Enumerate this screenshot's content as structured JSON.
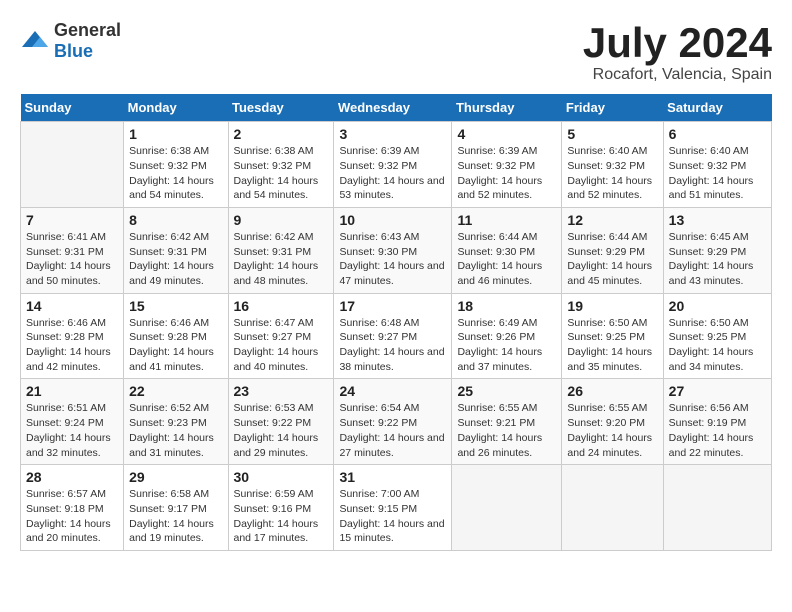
{
  "header": {
    "logo_general": "General",
    "logo_blue": "Blue",
    "title": "July 2024",
    "subtitle": "Rocafort, Valencia, Spain"
  },
  "days_of_week": [
    "Sunday",
    "Monday",
    "Tuesday",
    "Wednesday",
    "Thursday",
    "Friday",
    "Saturday"
  ],
  "weeks": [
    [
      {
        "day": "",
        "sunrise": "",
        "sunset": "",
        "daylight": "",
        "empty": true
      },
      {
        "day": "1",
        "sunrise": "Sunrise: 6:38 AM",
        "sunset": "Sunset: 9:32 PM",
        "daylight": "Daylight: 14 hours and 54 minutes."
      },
      {
        "day": "2",
        "sunrise": "Sunrise: 6:38 AM",
        "sunset": "Sunset: 9:32 PM",
        "daylight": "Daylight: 14 hours and 54 minutes."
      },
      {
        "day": "3",
        "sunrise": "Sunrise: 6:39 AM",
        "sunset": "Sunset: 9:32 PM",
        "daylight": "Daylight: 14 hours and 53 minutes."
      },
      {
        "day": "4",
        "sunrise": "Sunrise: 6:39 AM",
        "sunset": "Sunset: 9:32 PM",
        "daylight": "Daylight: 14 hours and 52 minutes."
      },
      {
        "day": "5",
        "sunrise": "Sunrise: 6:40 AM",
        "sunset": "Sunset: 9:32 PM",
        "daylight": "Daylight: 14 hours and 52 minutes."
      },
      {
        "day": "6",
        "sunrise": "Sunrise: 6:40 AM",
        "sunset": "Sunset: 9:32 PM",
        "daylight": "Daylight: 14 hours and 51 minutes."
      }
    ],
    [
      {
        "day": "7",
        "sunrise": "Sunrise: 6:41 AM",
        "sunset": "Sunset: 9:31 PM",
        "daylight": "Daylight: 14 hours and 50 minutes."
      },
      {
        "day": "8",
        "sunrise": "Sunrise: 6:42 AM",
        "sunset": "Sunset: 9:31 PM",
        "daylight": "Daylight: 14 hours and 49 minutes."
      },
      {
        "day": "9",
        "sunrise": "Sunrise: 6:42 AM",
        "sunset": "Sunset: 9:31 PM",
        "daylight": "Daylight: 14 hours and 48 minutes."
      },
      {
        "day": "10",
        "sunrise": "Sunrise: 6:43 AM",
        "sunset": "Sunset: 9:30 PM",
        "daylight": "Daylight: 14 hours and 47 minutes."
      },
      {
        "day": "11",
        "sunrise": "Sunrise: 6:44 AM",
        "sunset": "Sunset: 9:30 PM",
        "daylight": "Daylight: 14 hours and 46 minutes."
      },
      {
        "day": "12",
        "sunrise": "Sunrise: 6:44 AM",
        "sunset": "Sunset: 9:29 PM",
        "daylight": "Daylight: 14 hours and 45 minutes."
      },
      {
        "day": "13",
        "sunrise": "Sunrise: 6:45 AM",
        "sunset": "Sunset: 9:29 PM",
        "daylight": "Daylight: 14 hours and 43 minutes."
      }
    ],
    [
      {
        "day": "14",
        "sunrise": "Sunrise: 6:46 AM",
        "sunset": "Sunset: 9:28 PM",
        "daylight": "Daylight: 14 hours and 42 minutes."
      },
      {
        "day": "15",
        "sunrise": "Sunrise: 6:46 AM",
        "sunset": "Sunset: 9:28 PM",
        "daylight": "Daylight: 14 hours and 41 minutes."
      },
      {
        "day": "16",
        "sunrise": "Sunrise: 6:47 AM",
        "sunset": "Sunset: 9:27 PM",
        "daylight": "Daylight: 14 hours and 40 minutes."
      },
      {
        "day": "17",
        "sunrise": "Sunrise: 6:48 AM",
        "sunset": "Sunset: 9:27 PM",
        "daylight": "Daylight: 14 hours and 38 minutes."
      },
      {
        "day": "18",
        "sunrise": "Sunrise: 6:49 AM",
        "sunset": "Sunset: 9:26 PM",
        "daylight": "Daylight: 14 hours and 37 minutes."
      },
      {
        "day": "19",
        "sunrise": "Sunrise: 6:50 AM",
        "sunset": "Sunset: 9:25 PM",
        "daylight": "Daylight: 14 hours and 35 minutes."
      },
      {
        "day": "20",
        "sunrise": "Sunrise: 6:50 AM",
        "sunset": "Sunset: 9:25 PM",
        "daylight": "Daylight: 14 hours and 34 minutes."
      }
    ],
    [
      {
        "day": "21",
        "sunrise": "Sunrise: 6:51 AM",
        "sunset": "Sunset: 9:24 PM",
        "daylight": "Daylight: 14 hours and 32 minutes."
      },
      {
        "day": "22",
        "sunrise": "Sunrise: 6:52 AM",
        "sunset": "Sunset: 9:23 PM",
        "daylight": "Daylight: 14 hours and 31 minutes."
      },
      {
        "day": "23",
        "sunrise": "Sunrise: 6:53 AM",
        "sunset": "Sunset: 9:22 PM",
        "daylight": "Daylight: 14 hours and 29 minutes."
      },
      {
        "day": "24",
        "sunrise": "Sunrise: 6:54 AM",
        "sunset": "Sunset: 9:22 PM",
        "daylight": "Daylight: 14 hours and 27 minutes."
      },
      {
        "day": "25",
        "sunrise": "Sunrise: 6:55 AM",
        "sunset": "Sunset: 9:21 PM",
        "daylight": "Daylight: 14 hours and 26 minutes."
      },
      {
        "day": "26",
        "sunrise": "Sunrise: 6:55 AM",
        "sunset": "Sunset: 9:20 PM",
        "daylight": "Daylight: 14 hours and 24 minutes."
      },
      {
        "day": "27",
        "sunrise": "Sunrise: 6:56 AM",
        "sunset": "Sunset: 9:19 PM",
        "daylight": "Daylight: 14 hours and 22 minutes."
      }
    ],
    [
      {
        "day": "28",
        "sunrise": "Sunrise: 6:57 AM",
        "sunset": "Sunset: 9:18 PM",
        "daylight": "Daylight: 14 hours and 20 minutes."
      },
      {
        "day": "29",
        "sunrise": "Sunrise: 6:58 AM",
        "sunset": "Sunset: 9:17 PM",
        "daylight": "Daylight: 14 hours and 19 minutes."
      },
      {
        "day": "30",
        "sunrise": "Sunrise: 6:59 AM",
        "sunset": "Sunset: 9:16 PM",
        "daylight": "Daylight: 14 hours and 17 minutes."
      },
      {
        "day": "31",
        "sunrise": "Sunrise: 7:00 AM",
        "sunset": "Sunset: 9:15 PM",
        "daylight": "Daylight: 14 hours and 15 minutes."
      },
      {
        "day": "",
        "sunrise": "",
        "sunset": "",
        "daylight": "",
        "empty": true
      },
      {
        "day": "",
        "sunrise": "",
        "sunset": "",
        "daylight": "",
        "empty": true
      },
      {
        "day": "",
        "sunrise": "",
        "sunset": "",
        "daylight": "",
        "empty": true
      }
    ]
  ]
}
